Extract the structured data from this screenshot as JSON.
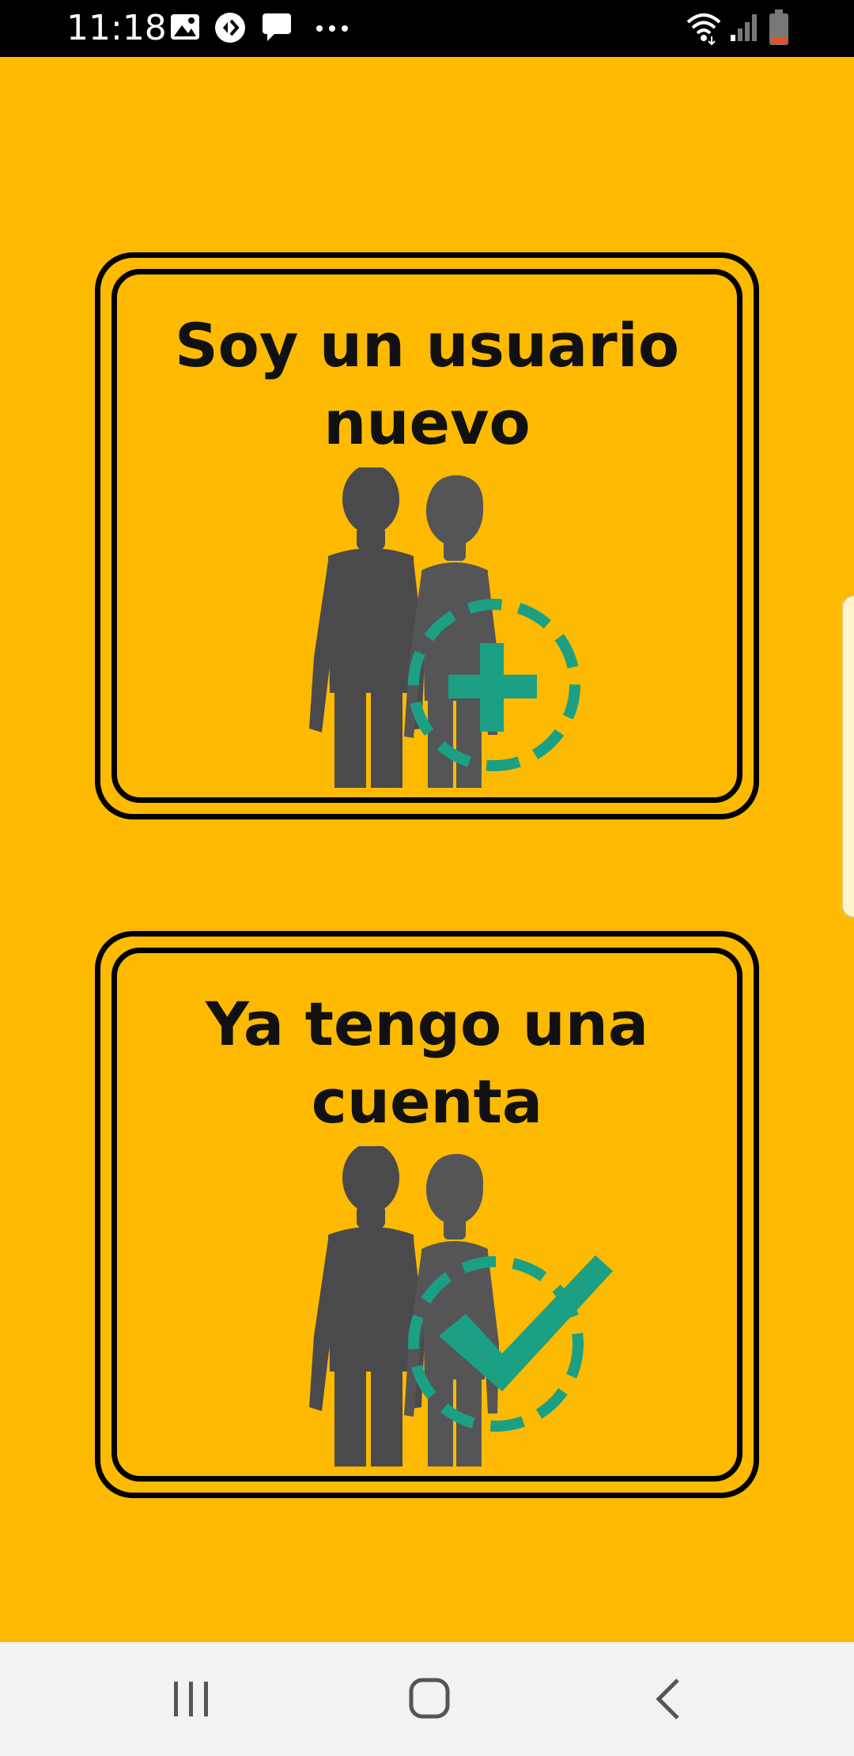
{
  "status_bar": {
    "time": "11:18",
    "left_icons": [
      "gallery-icon",
      "media-icon",
      "message-icon",
      "more-dots-icon"
    ],
    "right_icons": [
      "wifi-icon",
      "signal-icon",
      "battery-icon"
    ]
  },
  "cards": [
    {
      "title": "Soy un usuario nuevo",
      "illustration": "two-people-with-plus-icon",
      "accent_color": "#1BA083"
    },
    {
      "title": "Ya tengo una cuenta",
      "illustration": "two-people-with-check-icon",
      "accent_color": "#1BA083"
    }
  ],
  "nav_bar": {
    "buttons": [
      "recent-apps-icon",
      "home-icon",
      "back-icon"
    ]
  },
  "colors": {
    "background": "#FDBA00",
    "border": "#000000",
    "figure": "#4A4A4C",
    "accent": "#1BA083"
  }
}
